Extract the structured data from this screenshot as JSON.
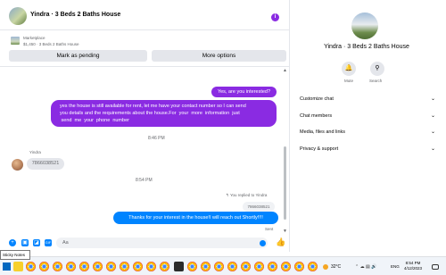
{
  "chat_header": {
    "title": "Yindra · 3 Beds 2 Baths House",
    "info_icon": "i"
  },
  "listing": {
    "category": "Marketplace",
    "description": "$1,450 · 3 Beds 2 Baths House",
    "mark_pending_label": "Mark as pending",
    "more_options_label": "More options"
  },
  "messages": {
    "out_1": "Yes, are you interested?",
    "out_2": "yes the house is still available for rent, let me have your contact number so I can send\nyou details and the requirements about the house.For  your  more  information  just\n send  me  your  phone  number",
    "time_1": "8:46 PM",
    "sender_name": "Yindra",
    "in_1": "7866038521",
    "time_2": "8:54 PM",
    "replied_label": "You replied to Yindra",
    "quoted": "7866038521",
    "out_3": "Thanks for your interest in the house!I will reach out Shortly!!!!",
    "status": "Sent"
  },
  "composer": {
    "placeholder": "Aa"
  },
  "side_panel": {
    "title": "Yindra · 3 Beds 2 Baths House",
    "mute_label": "Mute",
    "search_label": "Search",
    "items": [
      {
        "label": "Customize chat"
      },
      {
        "label": "Chat members"
      },
      {
        "label": "Media, files and links"
      },
      {
        "label": "Privacy & support"
      }
    ]
  },
  "taskbar": {
    "tooltip": "Sticky Notes",
    "temperature": "32°C",
    "language": "ENG",
    "time": "8:54 PM",
    "date": "4/12/2023"
  },
  "colors": {
    "outgoing_bubble": "#8a2be2",
    "recent_bubble": "#0084ff"
  }
}
